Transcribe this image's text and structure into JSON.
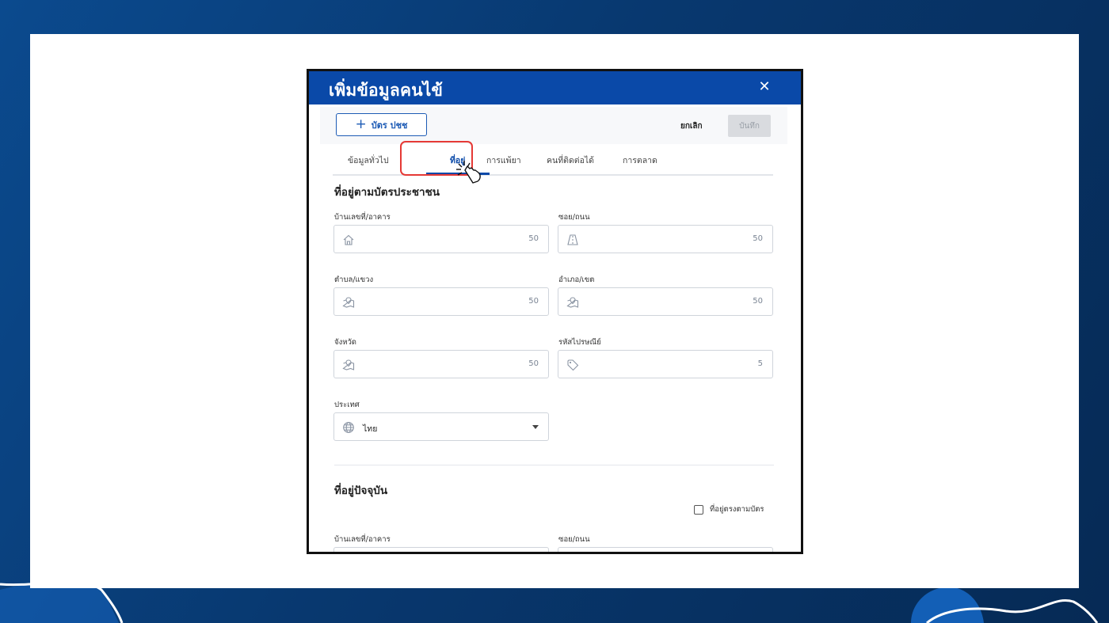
{
  "modal": {
    "title": "เพิ่มข้อมูลคนไข้",
    "close_label": "✕"
  },
  "toolbar": {
    "id_card_label": "บัตร ปชช",
    "cancel_label": "ยกเลิก",
    "save_label": "บันทึก"
  },
  "tabs": [
    {
      "label": "ข้อมูลทั่วไป",
      "active": false
    },
    {
      "label": "ที่อยู่",
      "active": true
    },
    {
      "label": "การแพ้ยา",
      "active": false
    },
    {
      "label": "คนที่ติดต่อได้",
      "active": false
    },
    {
      "label": "การตลาด",
      "active": false
    }
  ],
  "id_address": {
    "title": "ที่อยู่ตามบัตรประชาชน",
    "fields": {
      "house_no": {
        "label": "บ้านเลขที่/อาคาร",
        "icon": "home-icon",
        "counter": "50"
      },
      "soi": {
        "label": "ซอย/ถนน",
        "icon": "road-icon",
        "counter": "50"
      },
      "subdistrict": {
        "label": "ตำบล/แขวง",
        "icon": "map-pin-icon",
        "counter": "50"
      },
      "district": {
        "label": "อำเภอ/เขต",
        "icon": "map-pin-icon",
        "counter": "50"
      },
      "province": {
        "label": "จังหวัด",
        "icon": "map-pin-icon",
        "counter": "50"
      },
      "postcode": {
        "label": "รหัสไปรษณีย์",
        "icon": "tag-icon",
        "counter": "5"
      },
      "country": {
        "label": "ประเทศ",
        "icon": "globe-icon",
        "value": "ไทย"
      }
    }
  },
  "current_address": {
    "title": "ที่อยู่ปัจจุบัน",
    "same_as_card_label": "ที่อยู่ตรงตามบัตร",
    "fields": {
      "house_no": {
        "label": "บ้านเลขที่/อาคาร"
      },
      "soi": {
        "label": "ซอย/ถนน"
      }
    }
  },
  "colors": {
    "primary": "#0a49a8",
    "highlight": "#e53935",
    "background": "#08386f"
  }
}
